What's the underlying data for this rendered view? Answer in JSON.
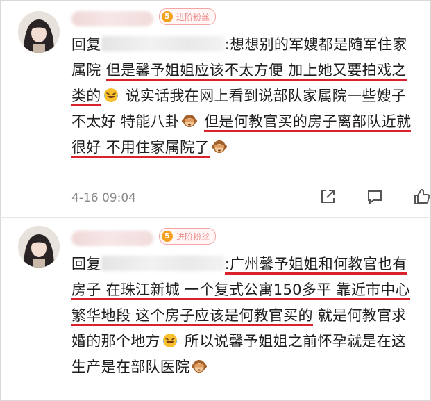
{
  "comments": [
    {
      "badge": {
        "level": "5",
        "label": "进阶粉丝"
      },
      "reply_prefix": "回复",
      "segments": [
        {
          "text": ":想想别的军嫂都是随军住家属院 ",
          "u": false
        },
        {
          "text": "但是馨予姐姐应该不太方便  加上她又要拍戏之类的",
          "u": true
        },
        {
          "emoji": "laugh-cry-icon"
        },
        {
          "text": "  说实话我在网上看到说部队家属院一些嫂子不太好  特能八卦",
          "u": false
        },
        {
          "emoji": "monkey-icon"
        },
        {
          "text": "  ",
          "u": false
        },
        {
          "text": "但是何教官买的房子离部队近就很好  不用住家属院了",
          "u": true
        },
        {
          "emoji": "monkey-icon"
        }
      ],
      "timestamp": "4-16 09:04"
    },
    {
      "badge": {
        "level": "5",
        "label": "进阶粉丝"
      },
      "reply_prefix": "回复",
      "segments": [
        {
          "text": ":广州馨予姐姐和何教官也有房子  在珠江新城   一个复式公寓150多平  靠近市中心繁华地段  这个房子应该是何教官买的",
          "u": true
        },
        {
          "text": "  就是何教官求婚的那个地方",
          "u": false
        },
        {
          "emoji": "laugh-cry-icon"
        },
        {
          "text": "  所以说馨予姐姐之前怀孕就是在这  生产是在部队医院",
          "u": false
        },
        {
          "emoji": "monkey-icon"
        }
      ]
    }
  ]
}
